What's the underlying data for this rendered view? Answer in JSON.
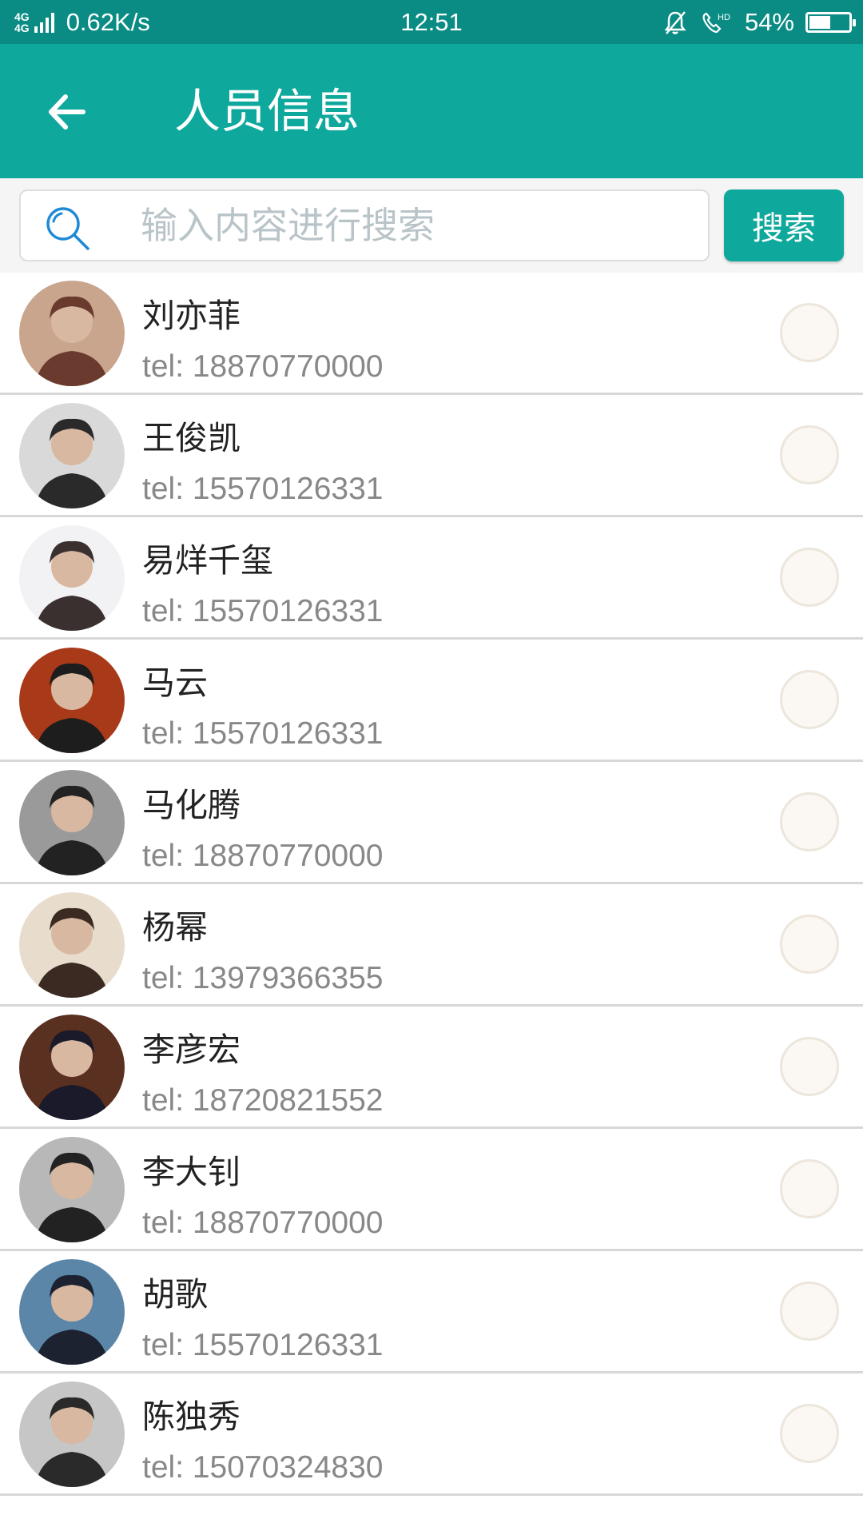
{
  "status_bar": {
    "network": "4G",
    "speed": "0.62K/s",
    "time": "12:51",
    "battery": "54%",
    "battery_level": 0.54,
    "icons": [
      "signal-icon",
      "mute-bell-icon",
      "hd-call-icon",
      "battery-icon"
    ]
  },
  "app_bar": {
    "title": "人员信息",
    "back_icon": "arrow-left-icon"
  },
  "search": {
    "placeholder": "输入内容进行搜索",
    "button_label": "搜索",
    "icon": "search-icon"
  },
  "colors": {
    "primary": "#0ea89c",
    "status_bar": "#0a8c84",
    "divider": "#d8d8d8",
    "tel_text": "#888888"
  },
  "people": [
    {
      "name": "刘亦菲",
      "tel": "tel: 18870770000",
      "avatar_tone": "#6b3a2e",
      "bg_tone": "#c9a58e"
    },
    {
      "name": "王俊凯",
      "tel": "tel: 15570126331",
      "avatar_tone": "#2a2a2a",
      "bg_tone": "#d9d9d9"
    },
    {
      "name": "易烊千玺",
      "tel": "tel: 15570126331",
      "avatar_tone": "#3a3030",
      "bg_tone": "#f2f2f4"
    },
    {
      "name": "马云",
      "tel": "tel: 15570126331",
      "avatar_tone": "#1d1d1d",
      "bg_tone": "#a83a1a"
    },
    {
      "name": "马化腾",
      "tel": "tel: 18870770000",
      "avatar_tone": "#222222",
      "bg_tone": "#9a9a9a"
    },
    {
      "name": "杨幂",
      "tel": "tel: 13979366355",
      "avatar_tone": "#3b2a22",
      "bg_tone": "#e8dccd"
    },
    {
      "name": "李彦宏",
      "tel": "tel: 18720821552",
      "avatar_tone": "#1a1a2a",
      "bg_tone": "#5a3020"
    },
    {
      "name": "李大钊",
      "tel": "tel: 18870770000",
      "avatar_tone": "#222222",
      "bg_tone": "#b8b8b8"
    },
    {
      "name": "胡歌",
      "tel": "tel: 15570126331",
      "avatar_tone": "#1c2230",
      "bg_tone": "#5c86a8"
    },
    {
      "name": "陈独秀",
      "tel": "tel: 15070324830",
      "avatar_tone": "#2a2a2a",
      "bg_tone": "#c6c6c6"
    }
  ]
}
